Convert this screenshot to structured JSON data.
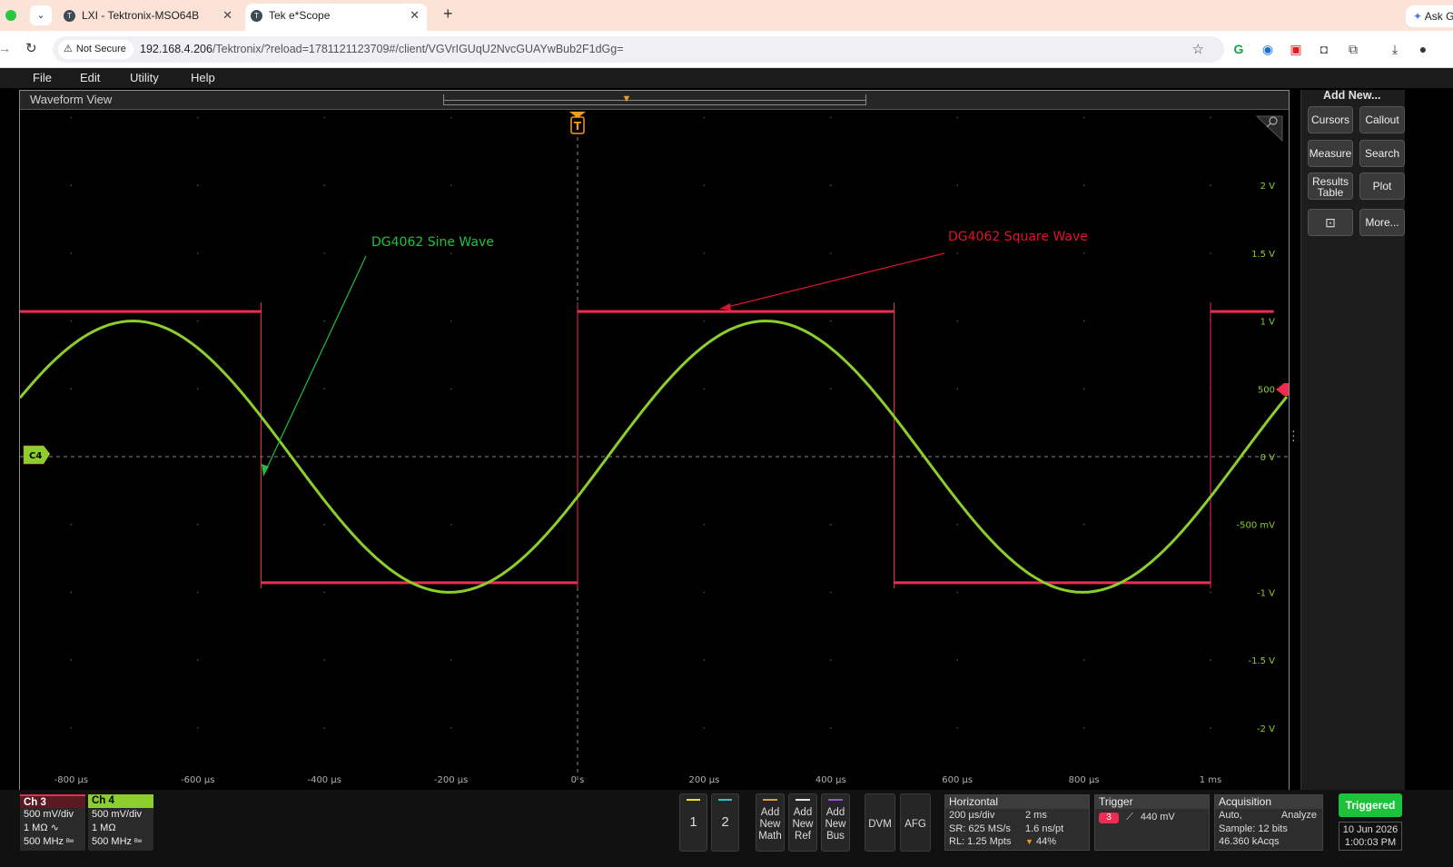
{
  "browser": {
    "tabs": [
      {
        "label": "LXI - Tektronix-MSO64B",
        "active": false
      },
      {
        "label": "Tek e*Scope",
        "active": true
      }
    ],
    "ask_label": "Ask G",
    "security_label": "Not Secure",
    "url_host": "192.168.4.206",
    "url_path": "/Tektronix/?reload=1781121123709#/client/VGVrIGUqU2NvcGUAYwBub2F1dGg="
  },
  "menu": [
    "File",
    "Edit",
    "Utility",
    "Help"
  ],
  "waveform_view": {
    "title": "Waveform View",
    "trigger_marker": "T",
    "y_labels": [
      "2 V",
      "1.5 V",
      "1 V",
      "500",
      "0 V",
      "-500 mV",
      "-1 V",
      "-1.5 V",
      "-2 V"
    ],
    "x_labels": [
      "-800 µs",
      "-600 µs",
      "-400 µs",
      "-200 µs",
      "0 s",
      "200 µs",
      "400 µs",
      "600 µs",
      "800 µs",
      "1 ms"
    ],
    "annotations": {
      "sine": "DG4062 Sine Wave",
      "square": "DG4062 Square Wave"
    },
    "channel_marker": "C4",
    "colors": {
      "ch3": "#ee2c52",
      "ch4": "#8ccf2c",
      "trigger": "#f29a1e",
      "annotation_green": "#1ec23a",
      "annotation_red": "#e0132c"
    }
  },
  "side_panel": {
    "title": "Add New...",
    "buttons": [
      "Cursors",
      "Callout",
      "Measure",
      "Search",
      "Results Table",
      "Plot",
      "zoom-icon",
      "More..."
    ]
  },
  "bottom": {
    "ch3": {
      "name": "Ch 3",
      "scale": "500 mV/div",
      "impedance": "1 MΩ",
      "bandwidth": "500 MHz"
    },
    "ch4": {
      "name": "Ch 4",
      "scale": "500 mV/div",
      "impedance": "1 MΩ",
      "bandwidth": "500 MHz"
    },
    "slot_buttons": [
      "1",
      "2"
    ],
    "add_buttons": [
      {
        "line1": "Add",
        "line2": "New",
        "line3": "Math"
      },
      {
        "line1": "Add",
        "line2": "New",
        "line3": "Ref"
      },
      {
        "line1": "Add",
        "line2": "New",
        "line3": "Bus"
      }
    ],
    "dvm_label": "DVM",
    "afg_label": "AFG",
    "horizontal": {
      "title": "Horizontal",
      "time_div": "200 µs/div",
      "duration": "2 ms",
      "sample_rate": "SR: 625 MS/s",
      "resolution": "1.6 ns/pt",
      "record_length": "RL: 1.25 Mpts",
      "position": "44%"
    },
    "trigger": {
      "title": "Trigger",
      "source": "3",
      "level": "440 mV"
    },
    "acquisition": {
      "title": "Acquisition",
      "mode": "Auto,",
      "analyze": "Analyze",
      "sample": "Sample: 12 bits",
      "acqs": "46.360 kAcqs"
    },
    "status": "Triggered",
    "date": "10 Jun 2026",
    "time": "1:00:03 PM"
  }
}
